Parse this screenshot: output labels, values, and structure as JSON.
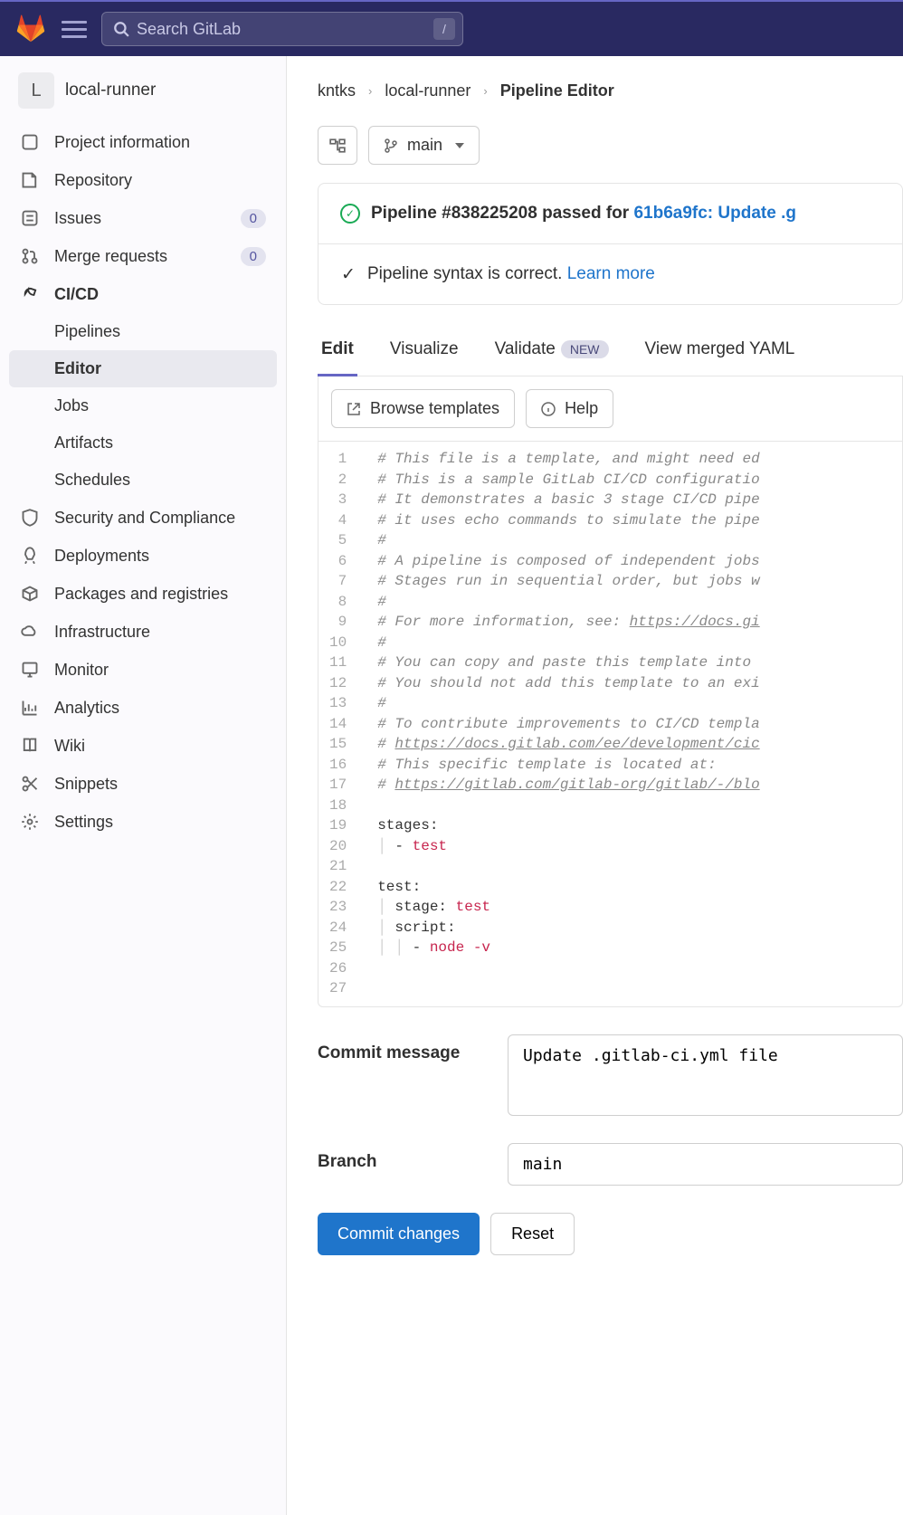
{
  "topbar": {
    "search_placeholder": "Search GitLab",
    "shortcut": "/"
  },
  "project": {
    "avatar_letter": "L",
    "name": "local-runner"
  },
  "sidebar": {
    "items": [
      {
        "label": "Project information"
      },
      {
        "label": "Repository"
      },
      {
        "label": "Issues",
        "badge": "0"
      },
      {
        "label": "Merge requests",
        "badge": "0"
      },
      {
        "label": "CI/CD"
      },
      {
        "label": "Security and Compliance"
      },
      {
        "label": "Deployments"
      },
      {
        "label": "Packages and registries"
      },
      {
        "label": "Infrastructure"
      },
      {
        "label": "Monitor"
      },
      {
        "label": "Analytics"
      },
      {
        "label": "Wiki"
      },
      {
        "label": "Snippets"
      },
      {
        "label": "Settings"
      }
    ],
    "cicd_sub": [
      {
        "label": "Pipelines"
      },
      {
        "label": "Editor"
      },
      {
        "label": "Jobs"
      },
      {
        "label": "Artifacts"
      },
      {
        "label": "Schedules"
      }
    ]
  },
  "breadcrumb": {
    "a": "kntks",
    "b": "local-runner",
    "c": "Pipeline Editor"
  },
  "branch_selector": "main",
  "status": {
    "pipeline_text": "Pipeline #838225208 passed for ",
    "pipeline_link": "61b6a9fc: Update .g",
    "syntax_text": "Pipeline syntax is correct. ",
    "syntax_link": "Learn more"
  },
  "tabs": {
    "edit": "Edit",
    "visualize": "Visualize",
    "validate": "Validate",
    "validate_badge": "NEW",
    "merged": "View merged YAML"
  },
  "editor_toolbar": {
    "browse": "Browse templates",
    "help": "Help"
  },
  "code_lines": [
    {
      "n": "1",
      "html": "<span class='comment'># This file is a template, and might need ed</span>"
    },
    {
      "n": "2",
      "html": "<span class='comment'># This is a sample GitLab CI/CD configuratio</span>"
    },
    {
      "n": "3",
      "html": "<span class='comment'># It demonstrates a basic 3 stage CI/CD pipe</span>"
    },
    {
      "n": "4",
      "html": "<span class='comment'># it uses echo commands to simulate the pipe</span>"
    },
    {
      "n": "5",
      "html": "<span class='comment'>#</span>"
    },
    {
      "n": "6",
      "html": "<span class='comment'># A pipeline is composed of independent jobs</span>"
    },
    {
      "n": "7",
      "html": "<span class='comment'># Stages run in sequential order, but jobs w</span>"
    },
    {
      "n": "8",
      "html": "<span class='comment'>#</span>"
    },
    {
      "n": "9",
      "html": "<span class='comment'># For more information, see: <span class='u'>https://docs.gi</span></span>"
    },
    {
      "n": "10",
      "html": "<span class='comment'>#</span>"
    },
    {
      "n": "11",
      "html": "<span class='comment'># You can copy and paste this template into </span>"
    },
    {
      "n": "12",
      "html": "<span class='comment'># You should not add this template to an exi</span>"
    },
    {
      "n": "13",
      "html": "<span class='comment'>#</span>"
    },
    {
      "n": "14",
      "html": "<span class='comment'># To contribute improvements to CI/CD templa</span>"
    },
    {
      "n": "15",
      "html": "<span class='comment'># <span class='u'>https://docs.gitlab.com/ee/development/cic</span></span>"
    },
    {
      "n": "16",
      "html": "<span class='comment'># This specific template is located at:</span>"
    },
    {
      "n": "17",
      "html": "<span class='comment'># <span class='u'>https://gitlab.com/gitlab-org/gitlab/-/blo</span></span>"
    },
    {
      "n": "18",
      "html": ""
    },
    {
      "n": "19",
      "html": "<span class='yaml-key'>stages:</span>"
    },
    {
      "n": "20",
      "html": "<span class='pipe'>│ </span>- <span class='yaml-val'>test</span>"
    },
    {
      "n": "21",
      "html": ""
    },
    {
      "n": "22",
      "html": "<span class='yaml-key'>test:</span>"
    },
    {
      "n": "23",
      "html": "<span class='pipe'>│ </span><span class='yaml-key'>stage:</span> <span class='yaml-val'>test</span>"
    },
    {
      "n": "24",
      "html": "<span class='pipe'>│ </span><span class='yaml-key'>script:</span>"
    },
    {
      "n": "25",
      "html": "<span class='pipe'>│ │ </span>- <span class='yaml-val'>node -v</span>"
    },
    {
      "n": "26",
      "html": ""
    },
    {
      "n": "27",
      "html": ""
    }
  ],
  "form": {
    "commit_label": "Commit message",
    "commit_value": "Update .gitlab-ci.yml file",
    "branch_label": "Branch",
    "branch_value": "main",
    "commit_btn": "Commit changes",
    "reset_btn": "Reset"
  }
}
